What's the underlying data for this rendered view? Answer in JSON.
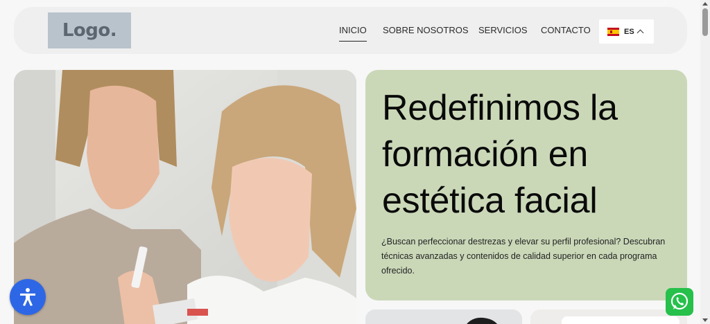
{
  "header": {
    "logo_text": "Logo.",
    "nav": [
      {
        "label": "INICIO",
        "active": true
      },
      {
        "label": "SOBRE NOSOTROS",
        "active": false
      },
      {
        "label": "SERVICIOS",
        "active": false
      },
      {
        "label": "CONTACTO",
        "active": false
      }
    ],
    "language": {
      "code": "ES",
      "flag_icon": "spain-flag-icon"
    }
  },
  "hero": {
    "title_line1": "Redefinimos la",
    "title_line2": "formación en",
    "title_line3": "estética facial",
    "description": "¿Buscan perfeccionar destrezas y elevar su perfil profesional? Descubran técnicas avanzadas y contenidos de calidad superior en cada programa ofrecido.",
    "card_color": "#cad8b8"
  },
  "floating": {
    "accessibility_icon": "accessibility-icon",
    "accessibility_color": "#2e67e6",
    "whatsapp_icon": "whatsapp-icon",
    "whatsapp_color": "#26c04b"
  }
}
